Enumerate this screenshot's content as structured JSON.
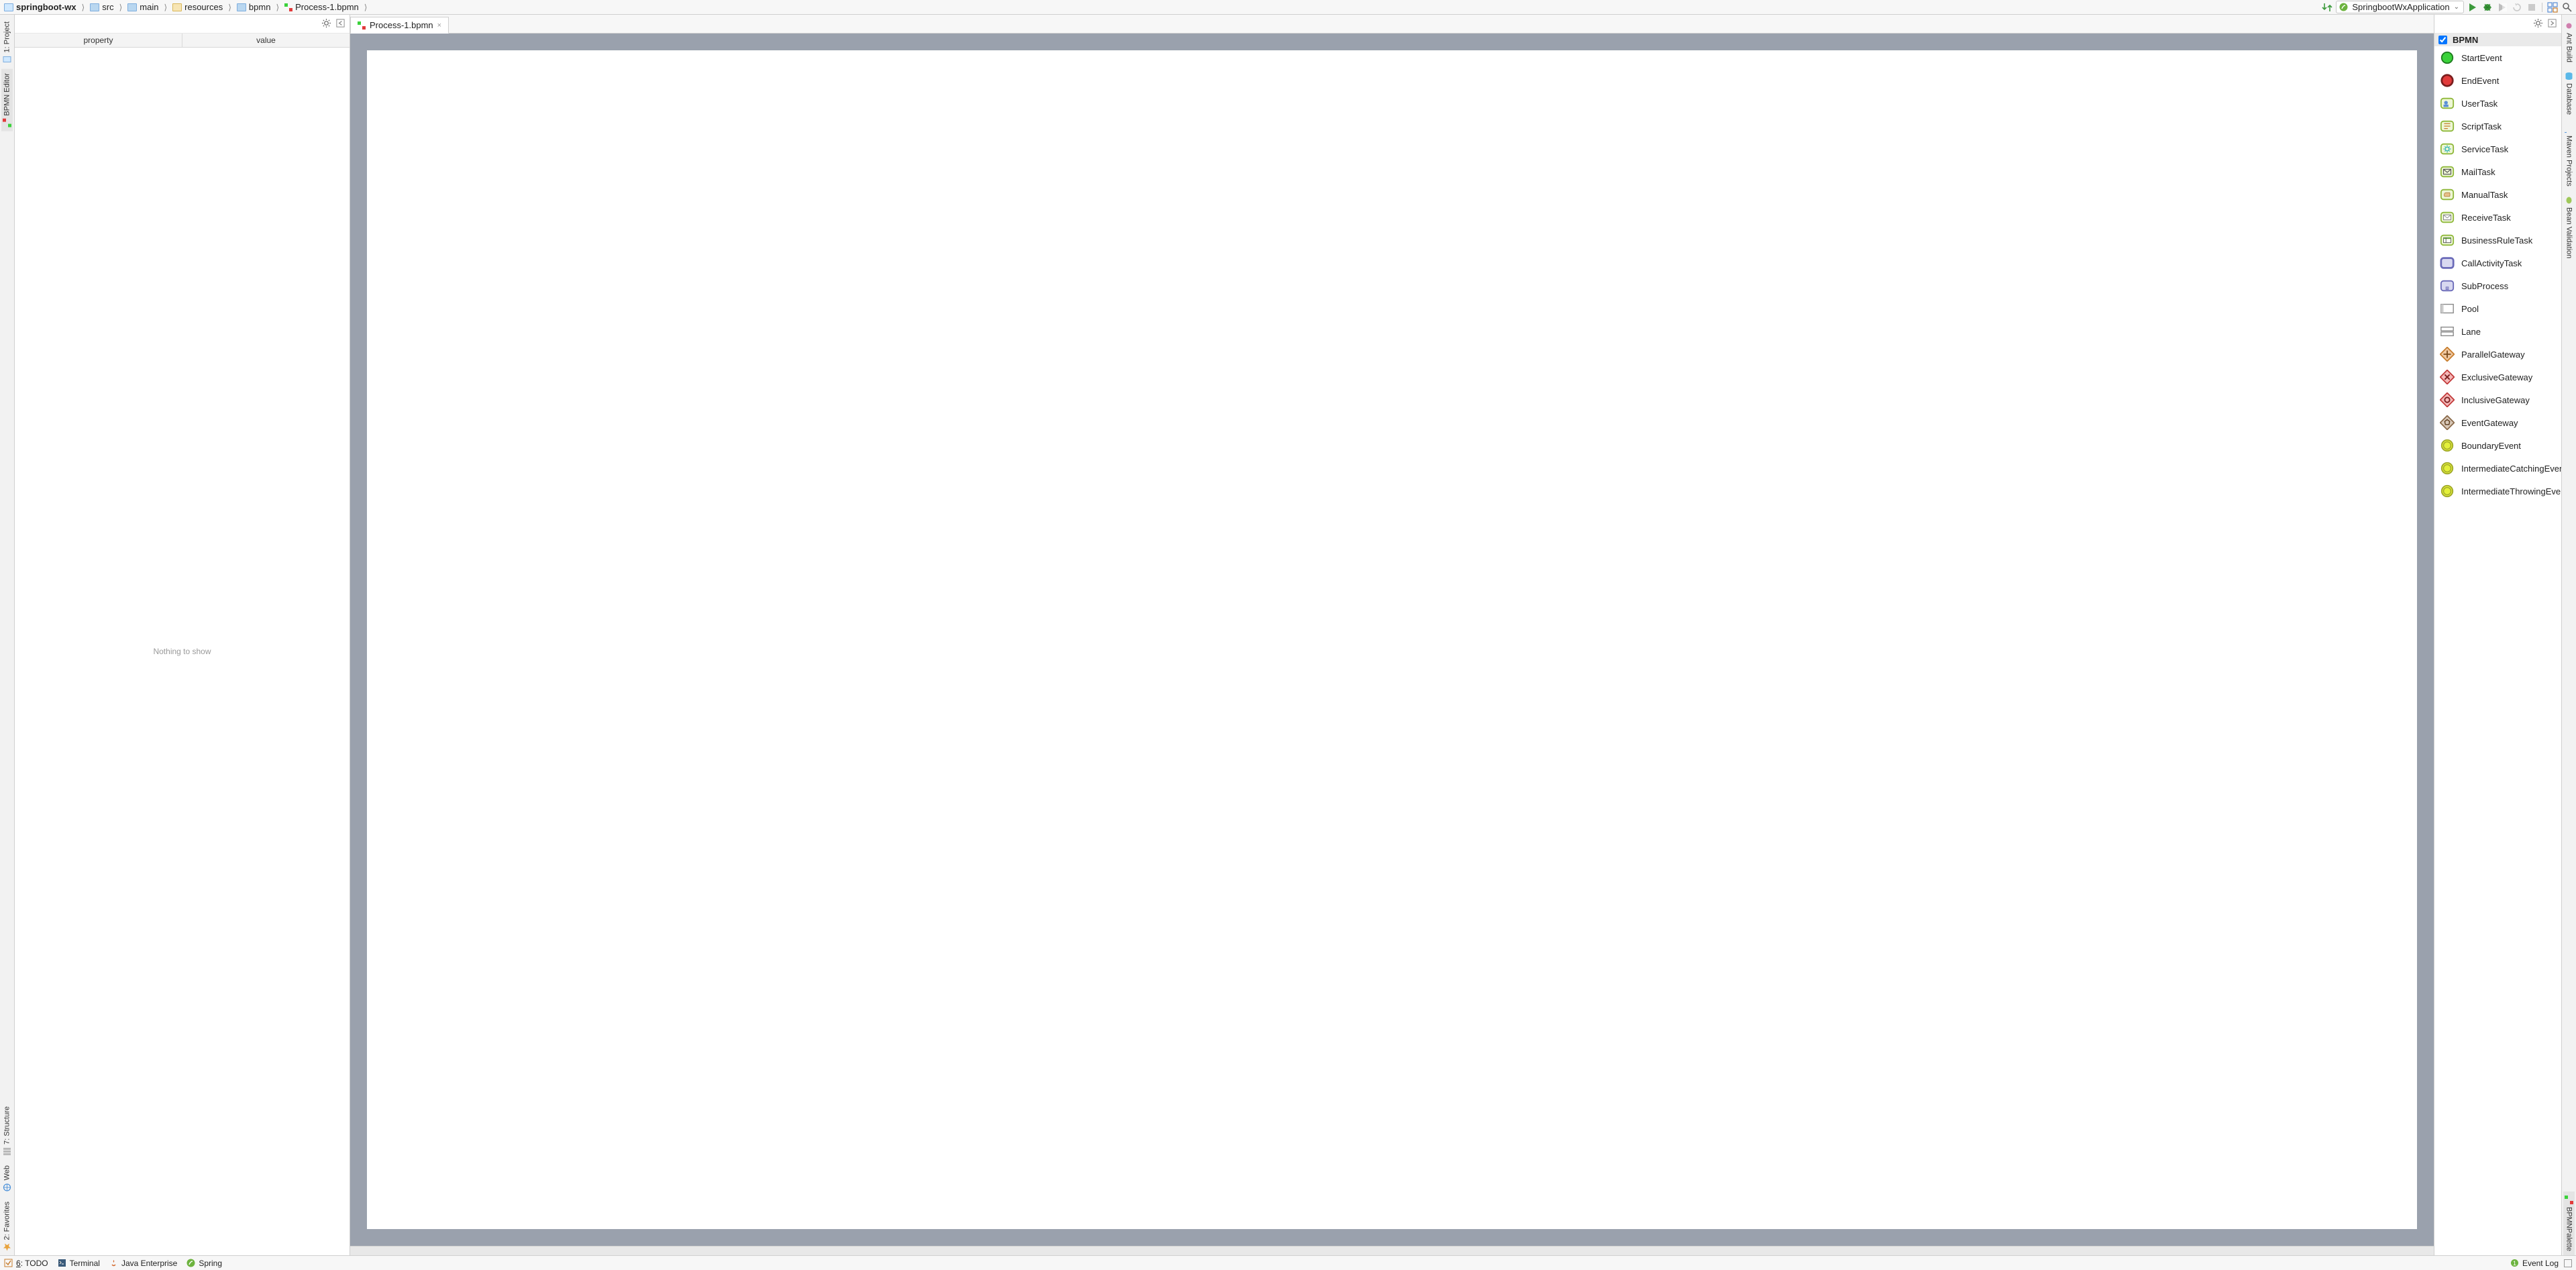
{
  "breadcrumbs": {
    "project": "springboot-wx",
    "src": "src",
    "main_dir": "main",
    "resources": "resources",
    "bpmn": "bpmn",
    "file": "Process-1.bpmn"
  },
  "run_config": {
    "name": "SpringbootWxApplication"
  },
  "left_strip": {
    "project": "1: Project",
    "bpmn_editor": "BPMN Editor",
    "structure": "7: Structure",
    "web": "Web",
    "favorites": "2: Favorites"
  },
  "right_strip": {
    "ant_build": "Ant Build",
    "database": "Database",
    "maven_projects": "Maven Projects",
    "bean_validation": "Bean Validation",
    "bpmn_palette": "BPMNPalette"
  },
  "property_table": {
    "col_property": "property",
    "col_value": "value",
    "empty_text": "Nothing to show"
  },
  "editor": {
    "tab_label": "Process-1.bpmn"
  },
  "palette": {
    "header": "BPMN",
    "items": [
      "StartEvent",
      "EndEvent",
      "UserTask",
      "ScriptTask",
      "ServiceTask",
      "MailTask",
      "ManualTask",
      "ReceiveTask",
      "BusinessRuleTask",
      "CallActivityTask",
      "SubProcess",
      "Pool",
      "Lane",
      "ParallelGateway",
      "ExclusiveGateway",
      "InclusiveGateway",
      "EventGateway",
      "BoundaryEvent",
      "IntermediateCatchingEvent",
      "IntermediateThrowingEvent"
    ]
  },
  "status": {
    "todo_num": "6",
    "todo": ": TODO",
    "terminal": "Terminal",
    "java_enterprise": "Java Enterprise",
    "spring": "Spring",
    "event_log": "Event Log"
  }
}
